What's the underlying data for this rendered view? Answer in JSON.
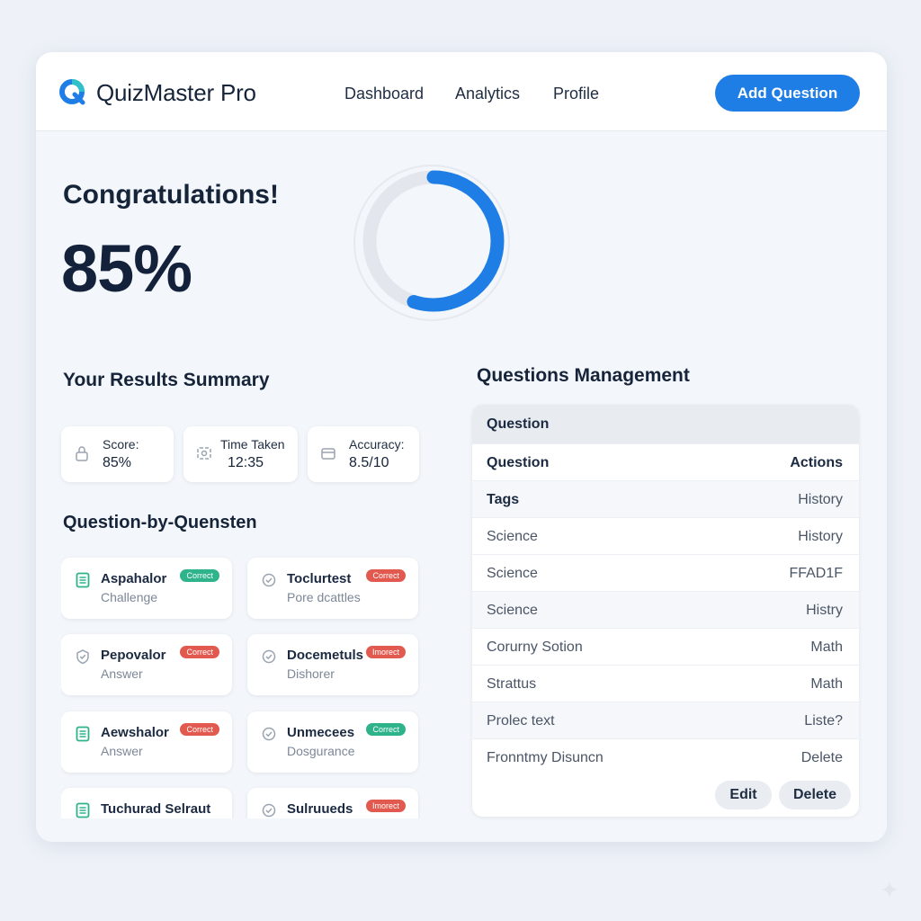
{
  "header": {
    "brand": "QuizMaster Pro",
    "nav": [
      "Dashboard",
      "Analytics",
      "Profile"
    ],
    "add_button": "Add Question",
    "accent": "#1e7ee6"
  },
  "hero": {
    "title": "Congratulations!",
    "score": "85%",
    "progress": 0.55
  },
  "summary": {
    "title": "Your Results Summary",
    "stats": [
      {
        "label": "Score:",
        "value": "85%",
        "icon": "lock-icon"
      },
      {
        "label": "Time Taken",
        "value": "12:35",
        "icon": "camera-icon"
      },
      {
        "label": "Accuracy:",
        "value": "8.5/10",
        "icon": "card-icon"
      }
    ]
  },
  "breakdown": {
    "title": "Question-by-Quensten",
    "items": [
      {
        "title": "Aspahalor",
        "sub": "Challenge",
        "badge": "Correct",
        "status": "green",
        "icon": "document-icon"
      },
      {
        "title": "Toclurtest",
        "sub": "Pore dcattles",
        "badge": "Correct",
        "status": "red",
        "icon": "check-circle-icon"
      },
      {
        "title": "Pepovalor",
        "sub": "Answer",
        "badge": "Correct",
        "status": "red",
        "icon": "check-shield-icon"
      },
      {
        "title": "Docemetuls",
        "sub": "Dishorer",
        "badge": "Imorect",
        "status": "red",
        "icon": "check-circle-icon"
      },
      {
        "title": "Aewshalor",
        "sub": "Answer",
        "badge": "Correct",
        "status": "red",
        "icon": "document-icon"
      },
      {
        "title": "Unmecees",
        "sub": "Dosgurance",
        "badge": "Correct",
        "status": "green",
        "icon": "check-circle-icon"
      },
      {
        "title": "Tuchurad Selraut",
        "sub": "",
        "badge": "",
        "status": "",
        "icon": "document-icon"
      },
      {
        "title": "Sulruueds",
        "sub": "",
        "badge": "Imorect",
        "status": "red",
        "icon": "check-circle-icon"
      }
    ]
  },
  "management": {
    "title": "Questions Management",
    "top_header": "Question",
    "col_left": "Question",
    "col_right": "Actions",
    "rows": [
      {
        "left": "Tags",
        "right": "History",
        "left_bold": true
      },
      {
        "left": "Science",
        "right": "History"
      },
      {
        "left": "Science",
        "right": "FFAD1F"
      },
      {
        "left": "Science",
        "right": "Histry"
      },
      {
        "left": "Corurny Sotion",
        "right": "Math"
      },
      {
        "left": "Strattus",
        "right": "Math"
      },
      {
        "left": "Prolec text",
        "right": "Liste?"
      },
      {
        "left": "Fronntmy Disuncn",
        "right": "Delete"
      }
    ],
    "edit_button": "Edit",
    "delete_button": "Delete"
  }
}
